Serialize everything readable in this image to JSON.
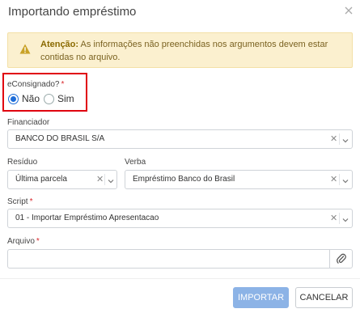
{
  "dialog": {
    "title": "Importando empréstimo",
    "close_icon": "close-icon"
  },
  "alert": {
    "icon": "warning-icon",
    "strong": "Atenção:",
    "text": " As informações não preenchidas nos argumentos devem estar contidas no arquivo."
  },
  "consignado": {
    "label": "eConsignado?",
    "required_mark": "*",
    "options": [
      {
        "label": "Não",
        "selected": true
      },
      {
        "label": "Sim",
        "selected": false
      }
    ]
  },
  "financiador": {
    "label": "Financiador",
    "value": "BANCO DO BRASIL S/A"
  },
  "residuo": {
    "label": "Resíduo",
    "value": "Última parcela"
  },
  "verba": {
    "label": "Verba",
    "value": "Empréstimo Banco do Brasil"
  },
  "script": {
    "label": "Script",
    "required_mark": "*",
    "value": "01 - Importar Empréstimo Apresentacao"
  },
  "arquivo": {
    "label": "Arquivo",
    "required_mark": "*",
    "value": "",
    "attach_icon": "paperclip-icon"
  },
  "footer": {
    "import_label": "IMPORTAR",
    "cancel_label": "CANCELAR"
  },
  "colors": {
    "accent": "#1e6dd8",
    "highlight_border": "#e0000f",
    "alert_bg": "#fbf0cf",
    "import_button": "#8cb3e6",
    "required": "#d9262b"
  }
}
